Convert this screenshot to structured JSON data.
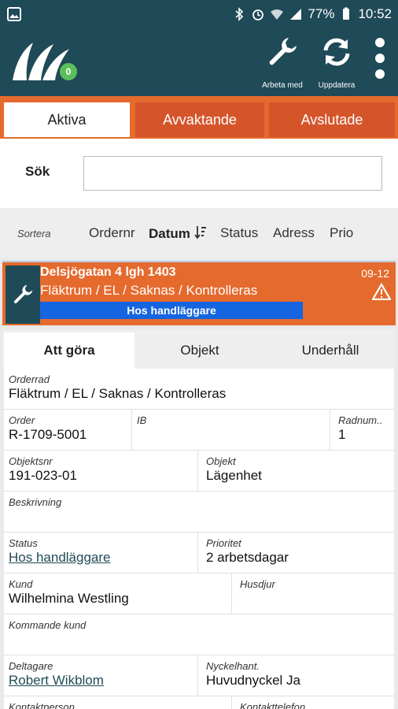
{
  "statusbar": {
    "battery": "77%",
    "time": "10:52"
  },
  "appbar": {
    "badge": "0",
    "actions": [
      {
        "label": "Arbeta med",
        "icon": "wrench-icon"
      },
      {
        "label": "Uppdatera",
        "icon": "refresh-icon"
      }
    ]
  },
  "tabs": [
    "Aktiva",
    "Avvaktande",
    "Avslutade"
  ],
  "search": {
    "label": "Sök",
    "value": ""
  },
  "sort": {
    "label": "Sortera",
    "options": [
      "Ordernr",
      "Datum",
      "Status",
      "Adress",
      "Prio"
    ],
    "active": "Datum"
  },
  "order": {
    "title": "Delsjögatan 4 lgh 1403",
    "subtitle": "Fläktrum / EL / Saknas / Kontrolleras",
    "date": "09-12",
    "status": "Hos handläggare"
  },
  "subtabs": [
    "Att göra",
    "Objekt",
    "Underhåll"
  ],
  "fields": {
    "orderrad": {
      "label": "Orderrad",
      "value": "Fläktrum / EL / Saknas / Kontrolleras"
    },
    "order": {
      "label": "Order",
      "value": "R-1709-5001"
    },
    "ib": {
      "label": "IB",
      "value": ""
    },
    "radnum": {
      "label": "Radnum..",
      "value": "1"
    },
    "objektsnr": {
      "label": "Objektsnr",
      "value": "191-023-01"
    },
    "objekt": {
      "label": "Objekt",
      "value": "Lägenhet"
    },
    "beskrivning": {
      "label": "Beskrivning",
      "value": ""
    },
    "status": {
      "label": "Status",
      "value": "Hos handläggare"
    },
    "prioritet": {
      "label": "Prioritet",
      "value": "2 arbetsdagar"
    },
    "kund": {
      "label": "Kund",
      "value": "Wilhelmina Westling"
    },
    "husdjur": {
      "label": "Husdjur",
      "value": ""
    },
    "kommande_kund": {
      "label": "Kommande kund",
      "value": ""
    },
    "deltagare": {
      "label": "Deltagare",
      "value": "Robert Wikblom"
    },
    "nyckelhant": {
      "label": "Nyckelhant.",
      "value": "Huvudnyckel Ja"
    },
    "kontaktperson": {
      "label": "Kontaktperson",
      "value": ""
    },
    "kontakttelefon": {
      "label": "Kontakttelefon",
      "value": ""
    }
  }
}
